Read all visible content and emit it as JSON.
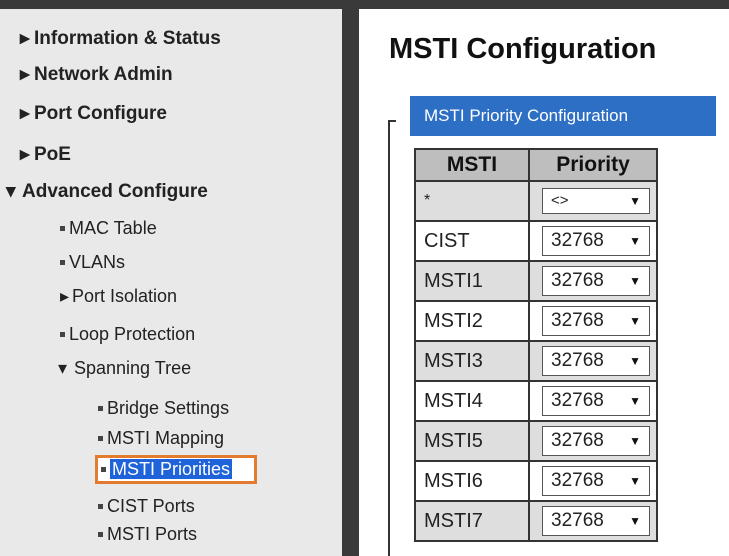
{
  "sidebar": {
    "items": [
      {
        "label": "Information & Status",
        "icon": "caret-right-icon"
      },
      {
        "label": "Network Admin",
        "icon": "caret-right-icon"
      },
      {
        "label": "Port Configure",
        "icon": "caret-right-icon"
      },
      {
        "label": "PoE",
        "icon": "caret-right-icon"
      },
      {
        "label": "Advanced Configure",
        "icon": "caret-down-icon"
      }
    ],
    "advanced": [
      {
        "label": "MAC Table"
      },
      {
        "label": "VLANs"
      },
      {
        "label": "Port Isolation"
      },
      {
        "label": "Loop Protection"
      },
      {
        "label": "Spanning Tree"
      }
    ],
    "spanning": [
      {
        "label": "Bridge Settings"
      },
      {
        "label": "MSTI Mapping"
      },
      {
        "label": "MSTI Priorities"
      },
      {
        "label": "CIST Ports"
      },
      {
        "label": "MSTI Ports"
      }
    ]
  },
  "main": {
    "title": "MSTI Configuration",
    "section_title": "MSTI Priority Configuration",
    "table": {
      "headers": {
        "msti": "MSTI",
        "priority": "Priority"
      },
      "rows": [
        {
          "msti": "*",
          "priority": "<>"
        },
        {
          "msti": "CIST",
          "priority": "32768"
        },
        {
          "msti": "MSTI1",
          "priority": "32768"
        },
        {
          "msti": "MSTI2",
          "priority": "32768"
        },
        {
          "msti": "MSTI3",
          "priority": "32768"
        },
        {
          "msti": "MSTI4",
          "priority": "32768"
        },
        {
          "msti": "MSTI5",
          "priority": "32768"
        },
        {
          "msti": "MSTI6",
          "priority": "32768"
        },
        {
          "msti": "MSTI7",
          "priority": "32768"
        }
      ]
    }
  },
  "colors": {
    "sidebar_bg": "#e9e9e9",
    "frame_dark": "#3a3a3a",
    "section_tab_bg": "#2d6fc5",
    "active_highlight": "#1e63d9",
    "active_border": "#e37b2f"
  }
}
